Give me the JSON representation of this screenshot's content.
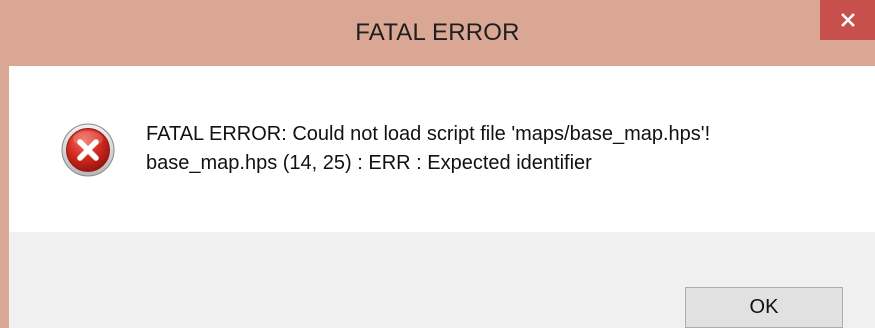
{
  "window": {
    "title": "FATAL ERROR",
    "close_icon": "close-icon",
    "close_button_color": "#c7504d",
    "frame_color": "#dba795"
  },
  "message": {
    "icon": "error-icon",
    "line1": "FATAL ERROR: Could not load script file 'maps/base_map.hps'!",
    "line2": "base_map.hps (14, 25) : ERR  : Expected identifier"
  },
  "buttons": {
    "ok_label": "OK"
  }
}
